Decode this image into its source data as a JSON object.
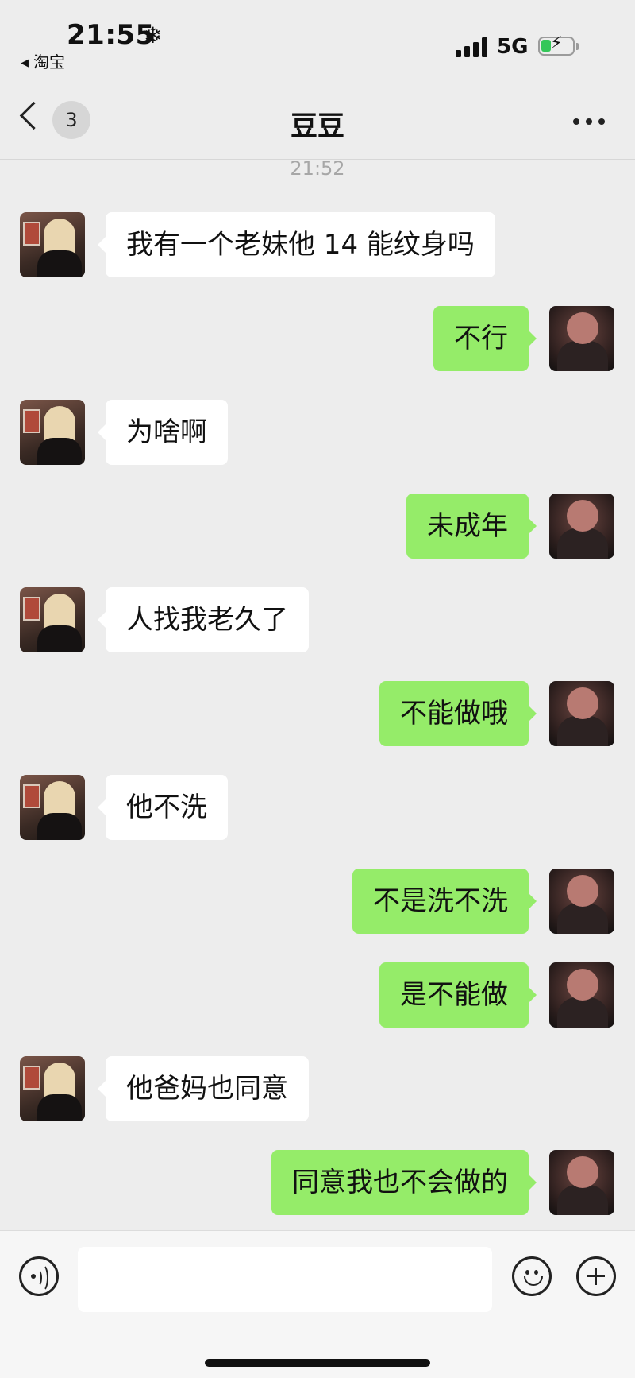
{
  "status_bar": {
    "time": "21:55",
    "weather_glyph": "❄",
    "back_app_label": "淘宝",
    "network": "5G",
    "battery_state": "charging"
  },
  "nav": {
    "unread_count": "3",
    "title": "豆豆"
  },
  "timestamp": "21:52",
  "messages": [
    {
      "side": "in",
      "text": "我有一个老妹他 14 能纹身吗"
    },
    {
      "side": "out",
      "text": "不行"
    },
    {
      "side": "in",
      "text": "为啥啊"
    },
    {
      "side": "out",
      "text": "未成年"
    },
    {
      "side": "in",
      "text": "人找我老久了"
    },
    {
      "side": "out",
      "text": "不能做哦"
    },
    {
      "side": "in",
      "text": "他不洗"
    },
    {
      "side": "out",
      "text": "不是洗不洗"
    },
    {
      "side": "out",
      "text": "是不能做"
    },
    {
      "side": "in",
      "text": "他爸妈也同意"
    },
    {
      "side": "out",
      "text": "同意我也不会做的"
    }
  ],
  "input": {
    "value": "",
    "placeholder": ""
  },
  "colors": {
    "background": "#ededed",
    "outgoing_bubble": "#95ec69",
    "incoming_bubble": "#ffffff",
    "timestamp": "#a7a7a7"
  },
  "icons": {
    "back": "chevron-left-icon",
    "more": "ellipsis-icon",
    "voice": "voice-icon",
    "emoji": "emoji-icon",
    "plus": "plus-icon"
  }
}
